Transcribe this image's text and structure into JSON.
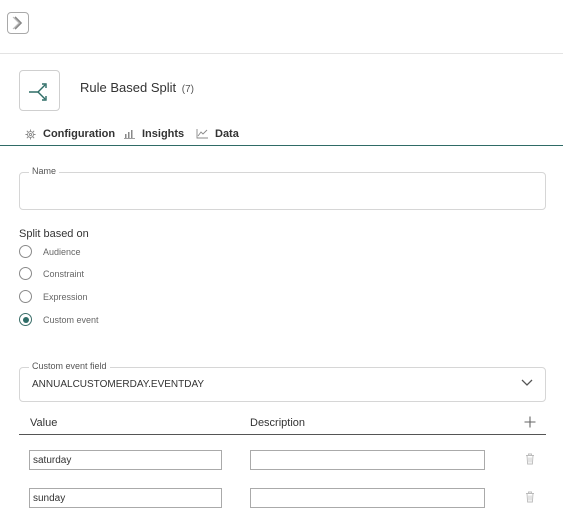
{
  "topbar": {
    "collapse_icon": "chevron-right-icon"
  },
  "node": {
    "icon": "split-arrow-icon",
    "title": "Rule Based Split",
    "count": "(7)"
  },
  "tabs": [
    {
      "label": "Configuration",
      "icon": "gear-icon"
    },
    {
      "label": "Insights",
      "icon": "bar-chart-icon"
    },
    {
      "label": "Data",
      "icon": "data-chart-icon"
    }
  ],
  "name_field": {
    "legend": "Name",
    "value": ""
  },
  "split": {
    "label": "Split based on",
    "options": [
      "Audience",
      "Constraint",
      "Expression",
      "Custom event"
    ],
    "selected": "Custom event"
  },
  "custom_event_field": {
    "legend": "Custom event field",
    "value": "ANNUALCUSTOMERDAY.EVENTDAY"
  },
  "table": {
    "columns": [
      "Value",
      "Description"
    ],
    "rows": [
      {
        "value": "saturday",
        "description": ""
      },
      {
        "value": "sunday",
        "description": ""
      }
    ]
  },
  "colors": {
    "accent": "#2e6d67",
    "border": "#d6d6d6"
  }
}
